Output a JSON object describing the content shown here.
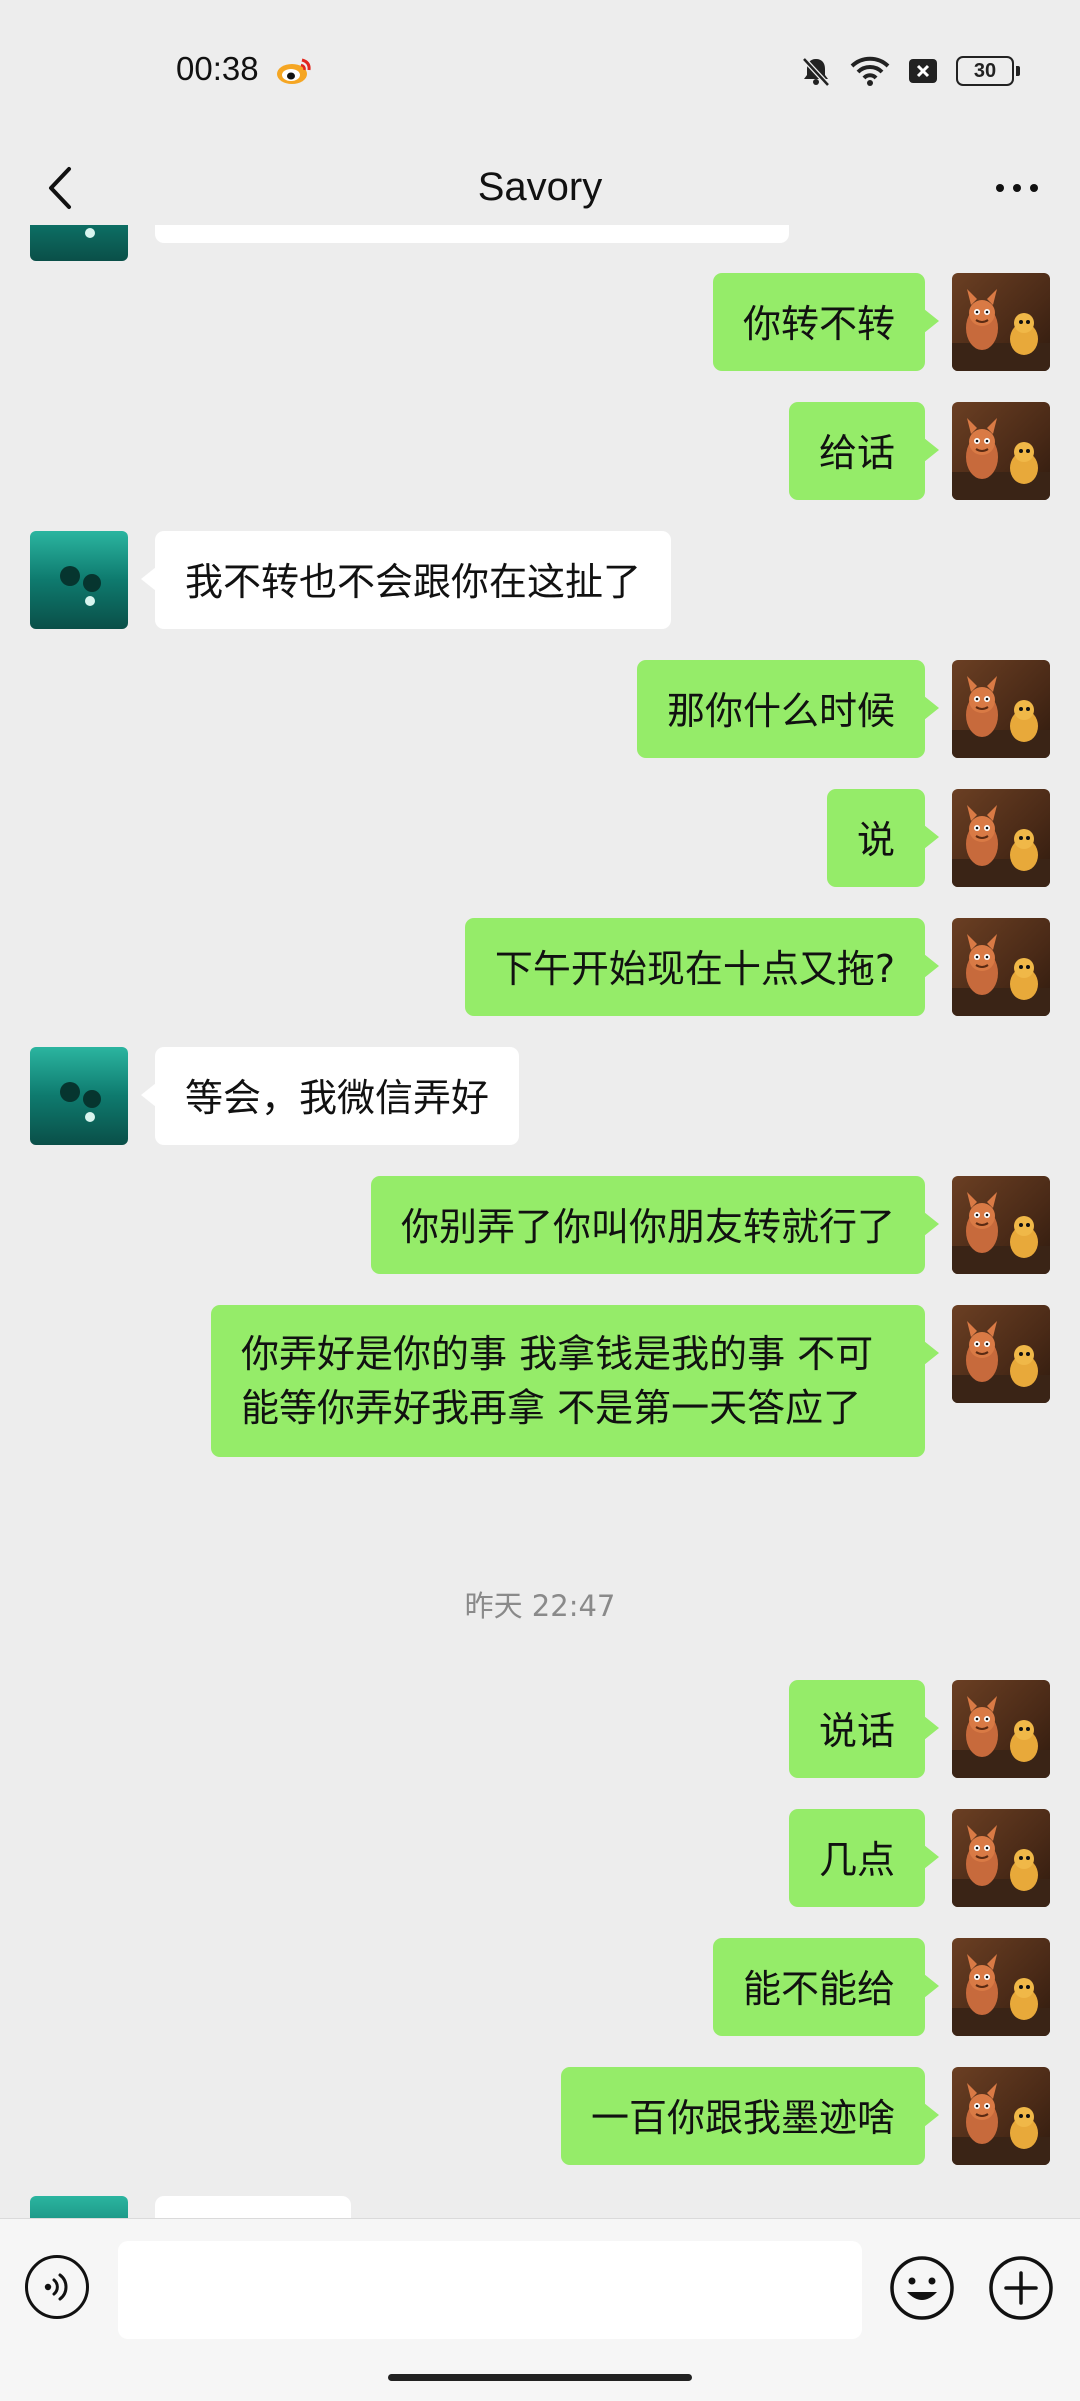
{
  "status_bar": {
    "time": "00:38",
    "battery": "30",
    "icons": [
      "weibo-icon",
      "mute-bell-icon",
      "wifi-icon",
      "sim-x-icon",
      "battery-icon"
    ]
  },
  "header": {
    "title": "Savory",
    "back_icon": "chevron-left-icon",
    "more_icon": "more-dots-icon"
  },
  "messages": [
    {
      "dir": "in",
      "text": ""
    },
    {
      "dir": "out",
      "text": "你转不转"
    },
    {
      "dir": "out",
      "text": "给话"
    },
    {
      "dir": "in",
      "text": "我不转也不会跟你在这扯了"
    },
    {
      "dir": "out",
      "text": "那你什么时候"
    },
    {
      "dir": "out",
      "text": "说"
    },
    {
      "dir": "out",
      "text": "下午开始现在十点又拖?"
    },
    {
      "dir": "in",
      "text": "等会，我微信弄好"
    },
    {
      "dir": "out",
      "text": "你别弄了你叫你朋友转就行了"
    },
    {
      "dir": "out",
      "text": "你弄好是你的事 我拿钱是我的事 不可能等你弄好我再拿 不是第一天答应了"
    },
    {
      "dir": "time",
      "text": "昨天 22:47"
    },
    {
      "dir": "out",
      "text": "说话"
    },
    {
      "dir": "out",
      "text": "几点"
    },
    {
      "dir": "out",
      "text": "能不能给"
    },
    {
      "dir": "out",
      "text": "一百你跟我墨迹啥"
    },
    {
      "dir": "in",
      "text": ""
    }
  ],
  "input_bar": {
    "voice_icon": "voice-icon",
    "placeholder": "",
    "emoji_icon": "emoji-icon",
    "plus_icon": "plus-icon"
  },
  "colors": {
    "background": "#ededed",
    "bubble_out": "#95ec69",
    "bubble_in": "#ffffff",
    "timestamp": "#8a8a8a"
  }
}
